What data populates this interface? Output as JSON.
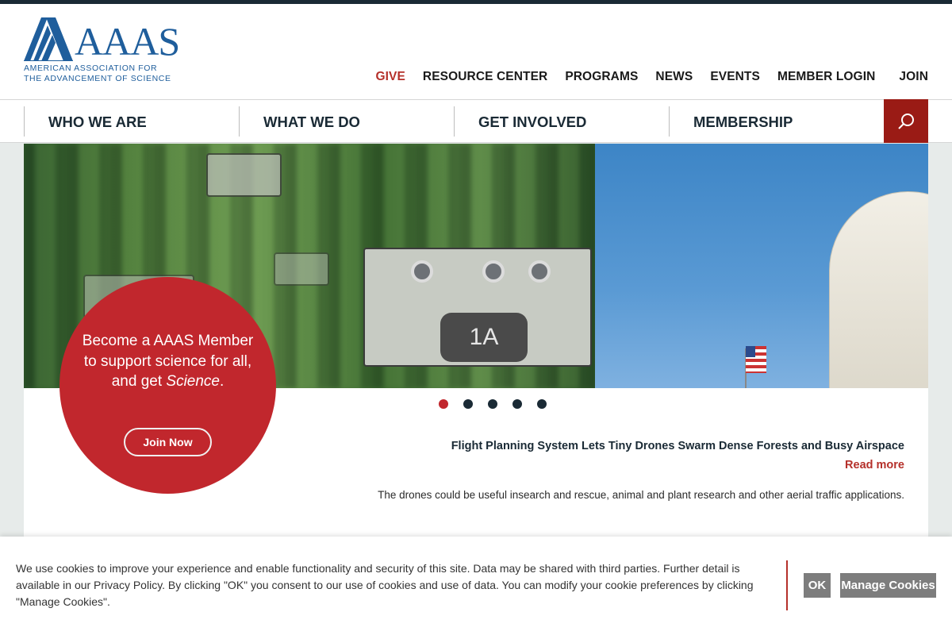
{
  "logo": {
    "wordmark": "AAAS",
    "line1": "AMERICAN ASSOCIATION FOR",
    "line2": "THE ADVANCEMENT OF SCIENCE"
  },
  "utility_nav": {
    "give": "GIVE",
    "resource_center": "RESOURCE CENTER",
    "programs": "PROGRAMS",
    "news": "NEWS",
    "events": "EVENTS",
    "member_login": "MEMBER LOGIN",
    "join": "JOIN"
  },
  "main_nav": {
    "items": [
      {
        "label": "WHO WE ARE"
      },
      {
        "label": "WHAT WE DO"
      },
      {
        "label": "GET INVOLVED"
      },
      {
        "label": "MEMBERSHIP"
      }
    ],
    "search_icon": "search-icon"
  },
  "hero": {
    "drone_tag": "1A",
    "slides_total": 5,
    "active_slide": 1
  },
  "story": {
    "title": "Flight Planning System Lets Tiny Drones Swarm Dense Forests and Busy Airspace",
    "read_more": "Read more",
    "description": "The drones could be useful insearch and rescue, animal and plant research and other aerial traffic applications."
  },
  "promo": {
    "text_before": "Become a AAAS Member to support science for all, and get ",
    "text_italic": "Science",
    "text_after": ".",
    "button": "Join Now"
  },
  "cookie": {
    "text": "We use cookies to improve your experience and enable functionality and security of this site. Data may be shared with third parties. Further detail is available in our Privacy Policy. By clicking \"OK\" you consent to our use of cookies and use of data. You can modify your cookie preferences by clicking \"Manage Cookies\".",
    "ok": "OK",
    "manage": "Manage Cookies"
  },
  "colors": {
    "brand_blue": "#1f5e9c",
    "accent_red": "#c1272d",
    "dark_navy": "#1a2a35",
    "button_gray": "#7d7d7d"
  }
}
